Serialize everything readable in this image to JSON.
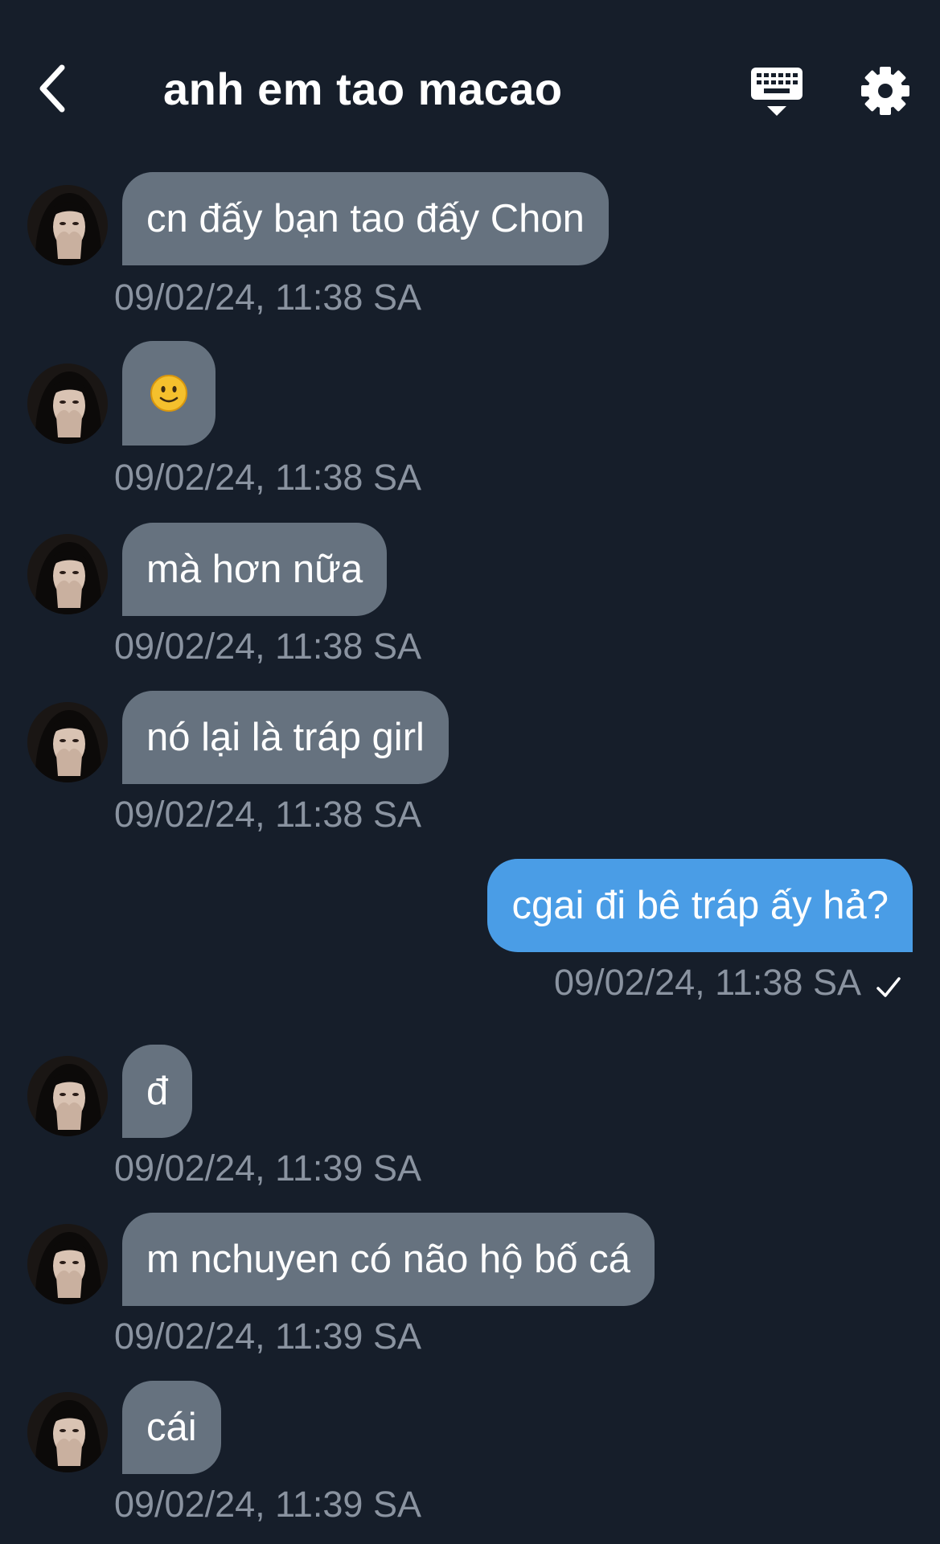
{
  "header": {
    "title": "anh em tao macao",
    "back_icon": "chevron-left-icon",
    "keyboard_icon": "keyboard-icon",
    "settings_icon": "gear-icon"
  },
  "colors": {
    "background": "#161e2a",
    "incoming_bubble": "#66727f",
    "outgoing_bubble": "#4a9de6",
    "timestamp": "#8a93a0"
  },
  "messages": [
    {
      "sender": "other",
      "text": "cn đấy bạn tao đấy Chon",
      "time": "09/02/24, 11:38 SA"
    },
    {
      "sender": "other",
      "text": "🙂",
      "time": "09/02/24, 11:38 SA"
    },
    {
      "sender": "other",
      "text": "mà hơn nữa",
      "time": "09/02/24, 11:38 SA"
    },
    {
      "sender": "other",
      "text": "nó lại là tráp girl",
      "time": "09/02/24, 11:38 SA"
    },
    {
      "sender": "me",
      "text": "cgai đi bê tráp ấy hả?",
      "time": "09/02/24, 11:38 SA",
      "status_icon": "check-icon"
    },
    {
      "sender": "other",
      "text": "đ",
      "time": "09/02/24, 11:39 SA"
    },
    {
      "sender": "other",
      "text": "m nchuyen có não hộ bố cá",
      "time": "09/02/24, 11:39 SA"
    },
    {
      "sender": "other",
      "text": "cái",
      "time": "09/02/24, 11:39 SA"
    }
  ]
}
